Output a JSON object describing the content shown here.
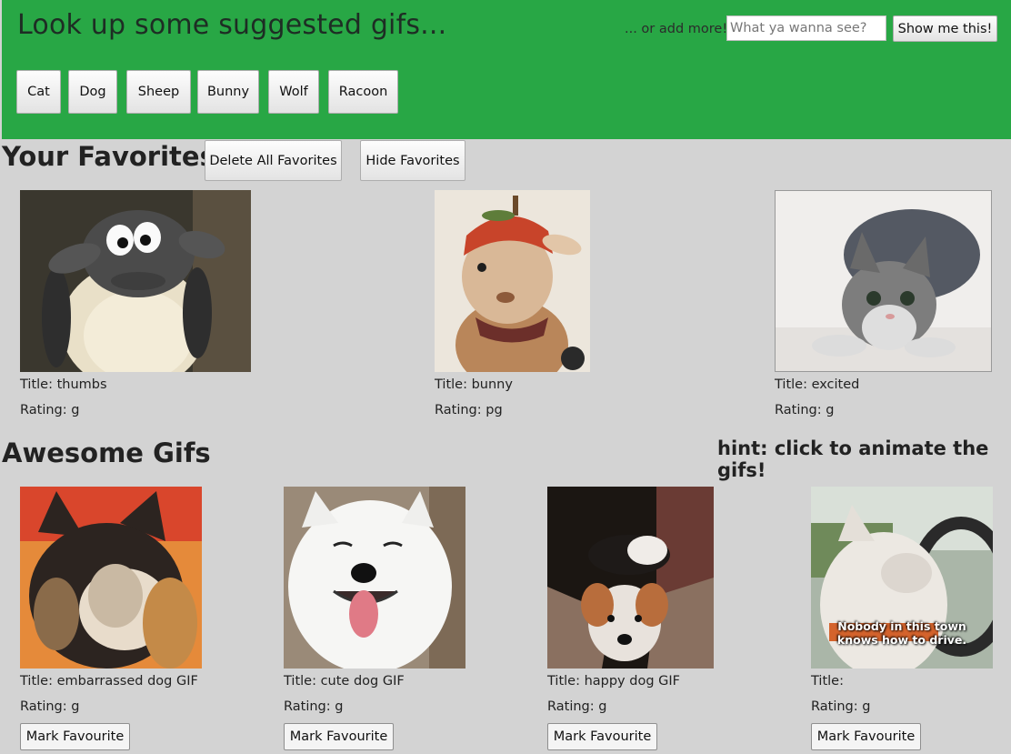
{
  "header": {
    "title": "Look up some suggested gifs...",
    "add_label": "... or add more!",
    "search_placeholder": "What ya wanna see?",
    "search_value": "",
    "show_button": "Show me this!",
    "suggestions": [
      "Cat",
      "Dog",
      "Sheep",
      "Bunny",
      "Wolf",
      "Racoon"
    ]
  },
  "favorites": {
    "title": "Your Favorites",
    "delete_all": "Delete All Favorites",
    "hide": "Hide Favorites",
    "items": [
      {
        "title": "Title: thumbs",
        "rating": "Rating: g"
      },
      {
        "title": "Title: bunny",
        "rating": "Rating: pg"
      },
      {
        "title": "Title: excited",
        "rating": "Rating: g"
      }
    ]
  },
  "gifs": {
    "title": "Awesome Gifs",
    "hint": "hint: click to animate the gifs!",
    "mark_label": "Mark Favourite",
    "items": [
      {
        "title": "Title: embarrassed dog GIF",
        "rating": "Rating: g"
      },
      {
        "title": "Title: cute dog GIF",
        "rating": "Rating: g"
      },
      {
        "title": "Title: happy dog GIF",
        "rating": "Rating: g"
      },
      {
        "title": "Title:",
        "rating": "Rating: g",
        "caption_line1": "Nobody in this town",
        "caption_line2": "knows how to drive."
      }
    ]
  },
  "colors": {
    "header_bg": "#28a745",
    "page_bg": "#d3d3d3"
  }
}
